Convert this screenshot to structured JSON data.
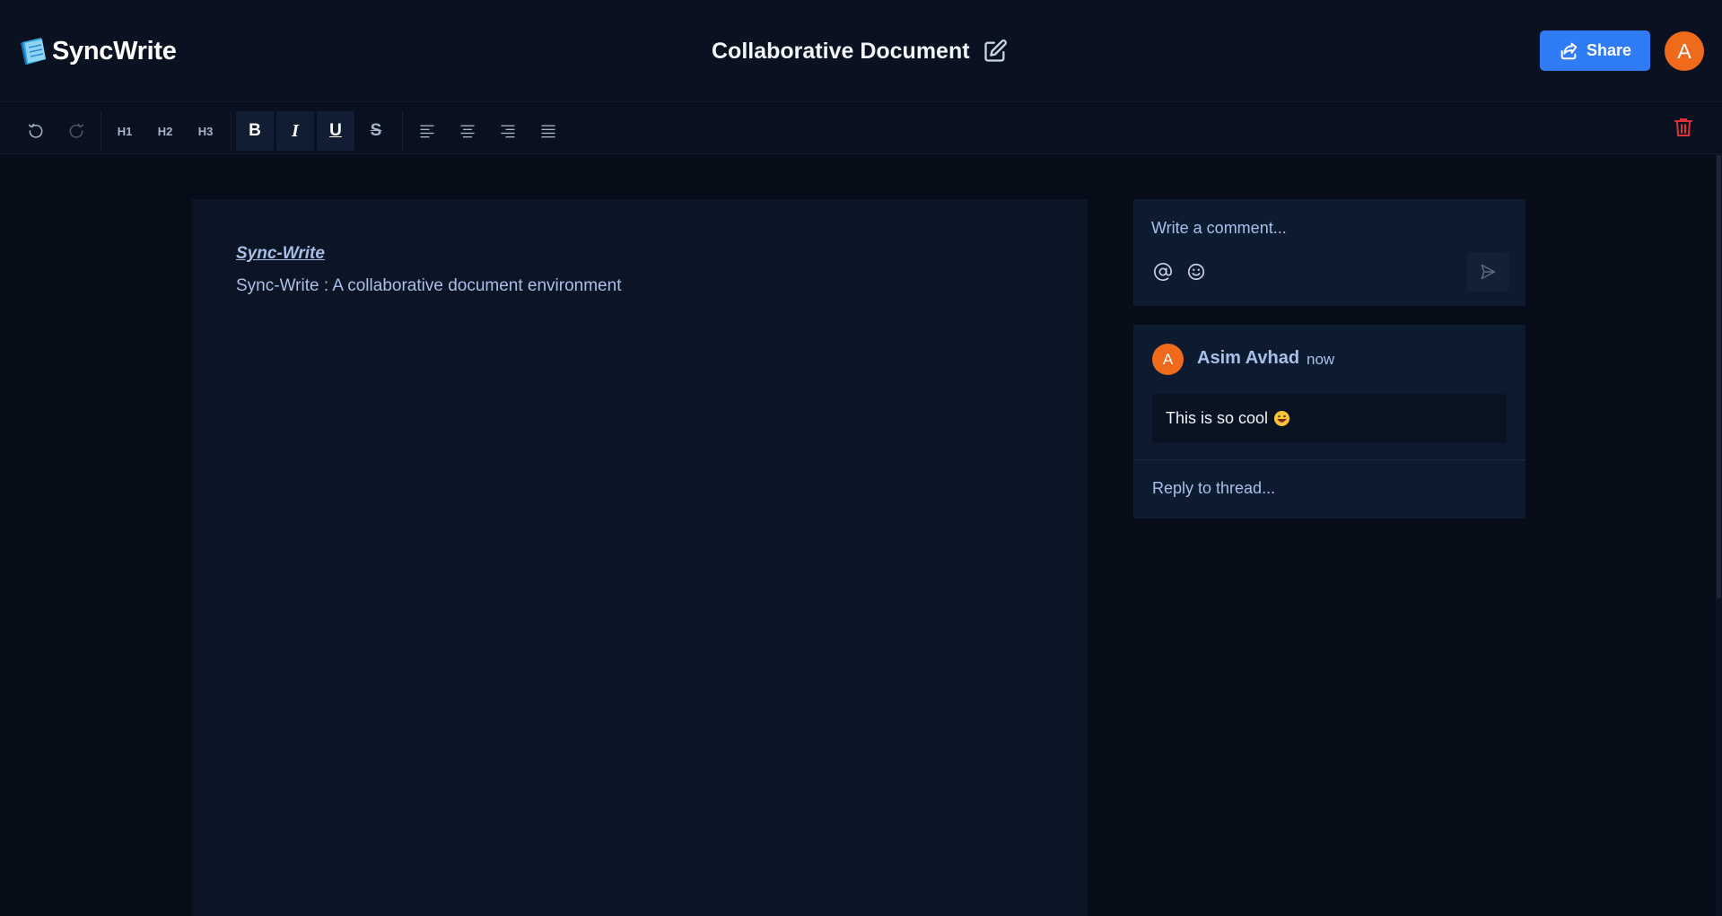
{
  "header": {
    "app_name": "SyncWrite",
    "doc_title": "Collaborative Document",
    "share_label": "Share",
    "user_initial": "A"
  },
  "toolbar": {
    "h1": "H1",
    "h2": "H2",
    "h3": "H3",
    "bold": "B",
    "italic": "I",
    "underline": "U",
    "strike": "S",
    "active_formats": [
      "bold",
      "italic",
      "underline"
    ]
  },
  "document": {
    "heading": "Sync-Write",
    "body": "Sync-Write : A collaborative document environment"
  },
  "comment_box": {
    "placeholder": "Write a comment..."
  },
  "thread": {
    "author_initial": "A",
    "author": "Asim Avhad",
    "time": "now",
    "message": "This is so cool",
    "reply_placeholder": "Reply to thread..."
  },
  "colors": {
    "background": "#070d18",
    "accent": "#2f7cf6",
    "avatar": "#f06a1b",
    "danger": "#e0303a",
    "link_text": "#a9c0e8"
  }
}
